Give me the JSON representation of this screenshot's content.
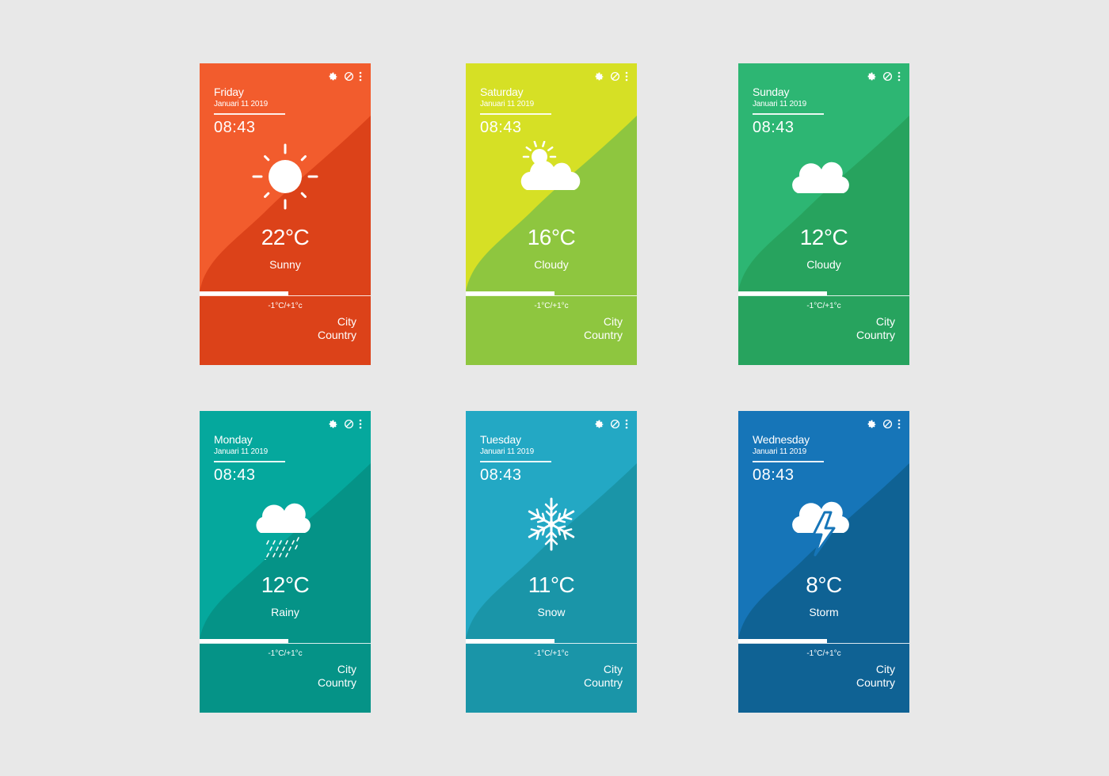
{
  "cards": [
    {
      "day": "Friday",
      "date": "Januari 11 2019",
      "time": "08:43",
      "temp": "22°C",
      "condition": "Sunny",
      "range": "-1°C/+1°c",
      "city": "City",
      "country": "Country",
      "progress": 0.52,
      "icon": "sun-icon",
      "colors": {
        "light": "#f25c2d",
        "dark": "#dc4219"
      }
    },
    {
      "day": "Saturday",
      "date": "Januari 11 2019",
      "time": "08:43",
      "temp": "16°C",
      "condition": "Cloudy",
      "range": "-1°C/+1°c",
      "city": "City",
      "country": "Country",
      "progress": 0.52,
      "icon": "partly-cloudy-icon",
      "colors": {
        "light": "#d6e025",
        "dark": "#8ec63f"
      }
    },
    {
      "day": "Sunday",
      "date": "Januari 11 2019",
      "time": "08:43",
      "temp": "12°C",
      "condition": "Cloudy",
      "range": "-1°C/+1°c",
      "city": "City",
      "country": "Country",
      "progress": 0.52,
      "icon": "cloud-icon",
      "colors": {
        "light": "#2db673",
        "dark": "#27a35e"
      }
    },
    {
      "day": "Monday",
      "date": "Januari 11 2019",
      "time": "08:43",
      "temp": "12°C",
      "condition": "Rainy",
      "range": "-1°C/+1°c",
      "city": "City",
      "country": "Country",
      "progress": 0.52,
      "icon": "rain-icon",
      "colors": {
        "light": "#05a89d",
        "dark": "#059387"
      }
    },
    {
      "day": "Tuesday",
      "date": "Januari 11 2019",
      "time": "08:43",
      "temp": "11°C",
      "condition": "Snow",
      "range": "-1°C/+1°c",
      "city": "City",
      "country": "Country",
      "progress": 0.52,
      "icon": "snowflake-icon",
      "colors": {
        "light": "#23a8c4",
        "dark": "#1a95a8"
      }
    },
    {
      "day": "Wednesday",
      "date": "Januari 11 2019",
      "time": "08:43",
      "temp": "8°C",
      "condition": "Storm",
      "range": "-1°C/+1°c",
      "city": "City",
      "country": "Country",
      "progress": 0.52,
      "icon": "storm-icon",
      "colors": {
        "light": "#1675b8",
        "dark": "#0f6294"
      }
    }
  ],
  "toolbar_icons": [
    "gear-icon",
    "block-icon",
    "more-vertical-icon"
  ]
}
